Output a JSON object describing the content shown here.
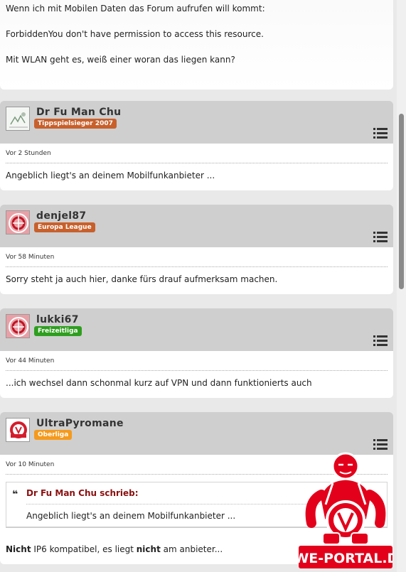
{
  "first_post": {
    "line1": "Wenn ich mit Mobilen Daten das Forum aufrufen will kommt:",
    "line2": "ForbiddenYou don't have permission to access this resource.",
    "line3": "Mit WLAN geht es, weiß einer woran das liegen kann?"
  },
  "posts": [
    {
      "username": "Dr Fu Man Chu",
      "badge": "Tippspielsieger 2007",
      "badge_color": "#c8602c",
      "time": "Vor 2 Stunden",
      "text": "Angeblich liegt's an deinem Mobilfunkanbieter ..."
    },
    {
      "username": "denjel87",
      "badge": "Europa League",
      "badge_color": "#c8602c",
      "time": "Vor 58 Minuten",
      "text": "Sorry steht ja auch hier, danke fürs drauf aufmerksam machen."
    },
    {
      "username": "lukki67",
      "badge": "Freizeitliga",
      "badge_color": "#2e9e1e",
      "time": "Vor 44 Minuten",
      "text": "...ich wechsel dann schonmal kurz auf VPN und dann funktionierts auch"
    },
    {
      "username": "UltraPyromane",
      "badge": "Oberliga",
      "badge_color": "#f59a1c",
      "time": "Vor 10 Minuten",
      "quote_author": "Dr Fu Man Chu schrieb:",
      "quote_text": "Angeblich liegt's an deinem Mobilfunkanbieter ...",
      "text_part1": "Nicht",
      "text_part2": " IP6 kompatibel, es liegt ",
      "text_part3": "nicht",
      "text_part4": " am anbieter..."
    }
  ],
  "logo_text": "RWE-PORTAL.DE",
  "colors": {
    "header_bg": "#cfcfcf",
    "quote_author": "#8b1010",
    "logo_red": "#e3001b"
  }
}
